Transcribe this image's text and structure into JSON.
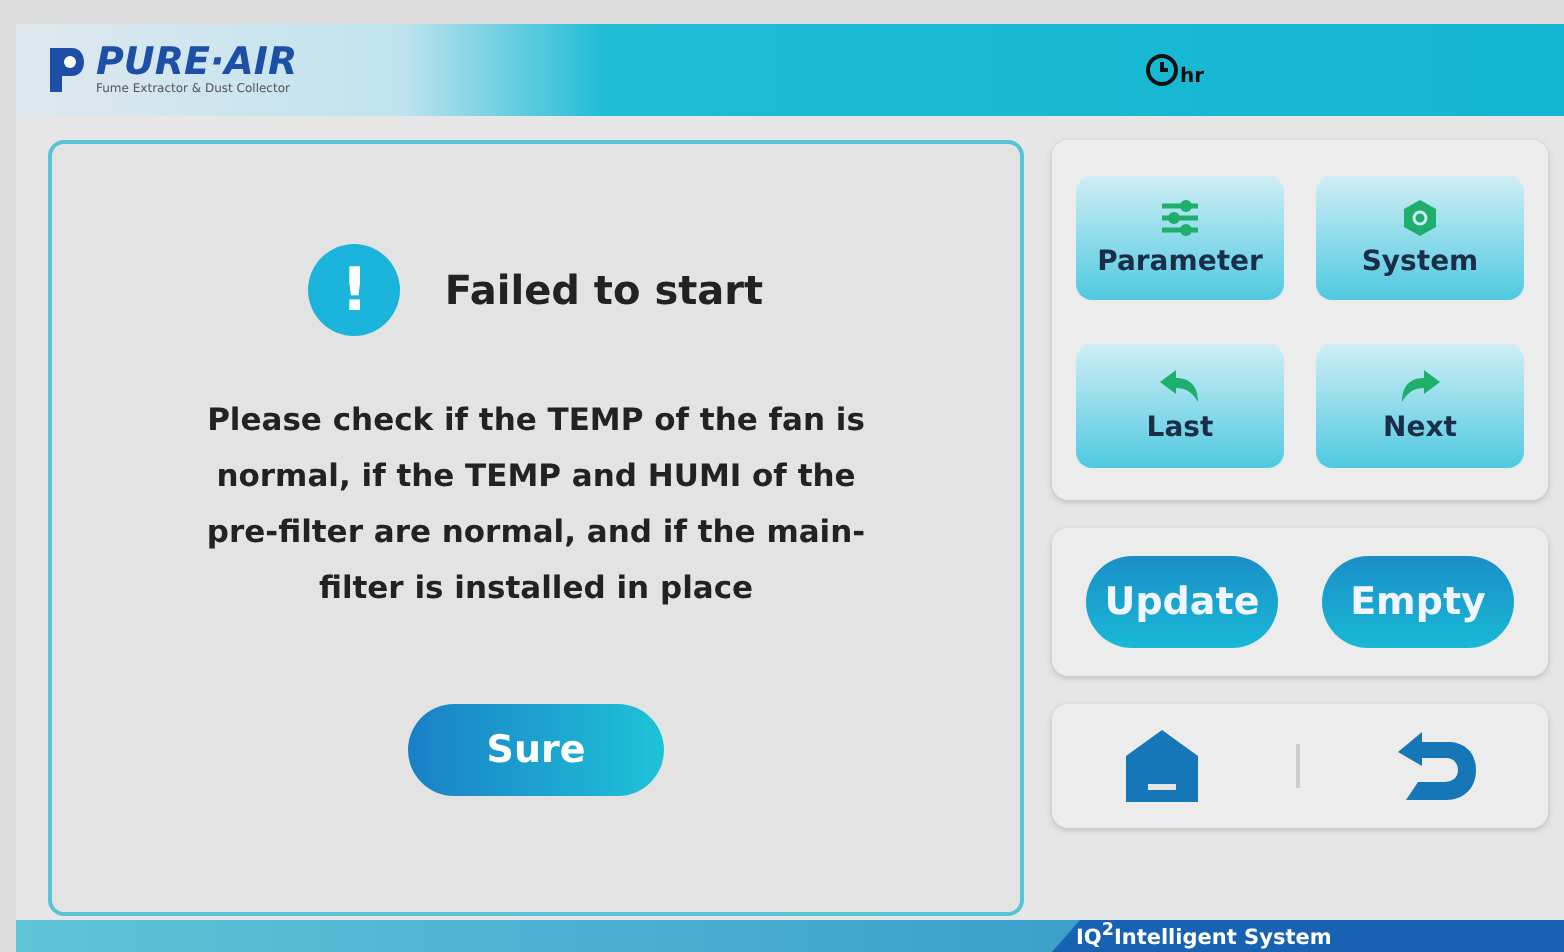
{
  "header": {
    "logo": {
      "brand": "PURE·AIR",
      "tagline": "Fume Extractor & Dust Collector"
    },
    "timer_unit": "hr"
  },
  "dialog": {
    "title": "Failed to start",
    "icon": "!",
    "message": "Please check if the TEMP of the fan is normal, if the TEMP and HUMI of the pre-filter are normal, and if the main-filter is installed in place",
    "button": "Sure"
  },
  "nav_buttons": [
    {
      "kind": "parameter",
      "label": "Parameter"
    },
    {
      "kind": "system",
      "label": "System"
    },
    {
      "kind": "last",
      "label": "Last"
    },
    {
      "kind": "next",
      "label": "Next"
    }
  ],
  "action_buttons": [
    "Update",
    "Empty"
  ],
  "footer": {
    "system_name": "IQ$^{2}$Intelligent System"
  }
}
